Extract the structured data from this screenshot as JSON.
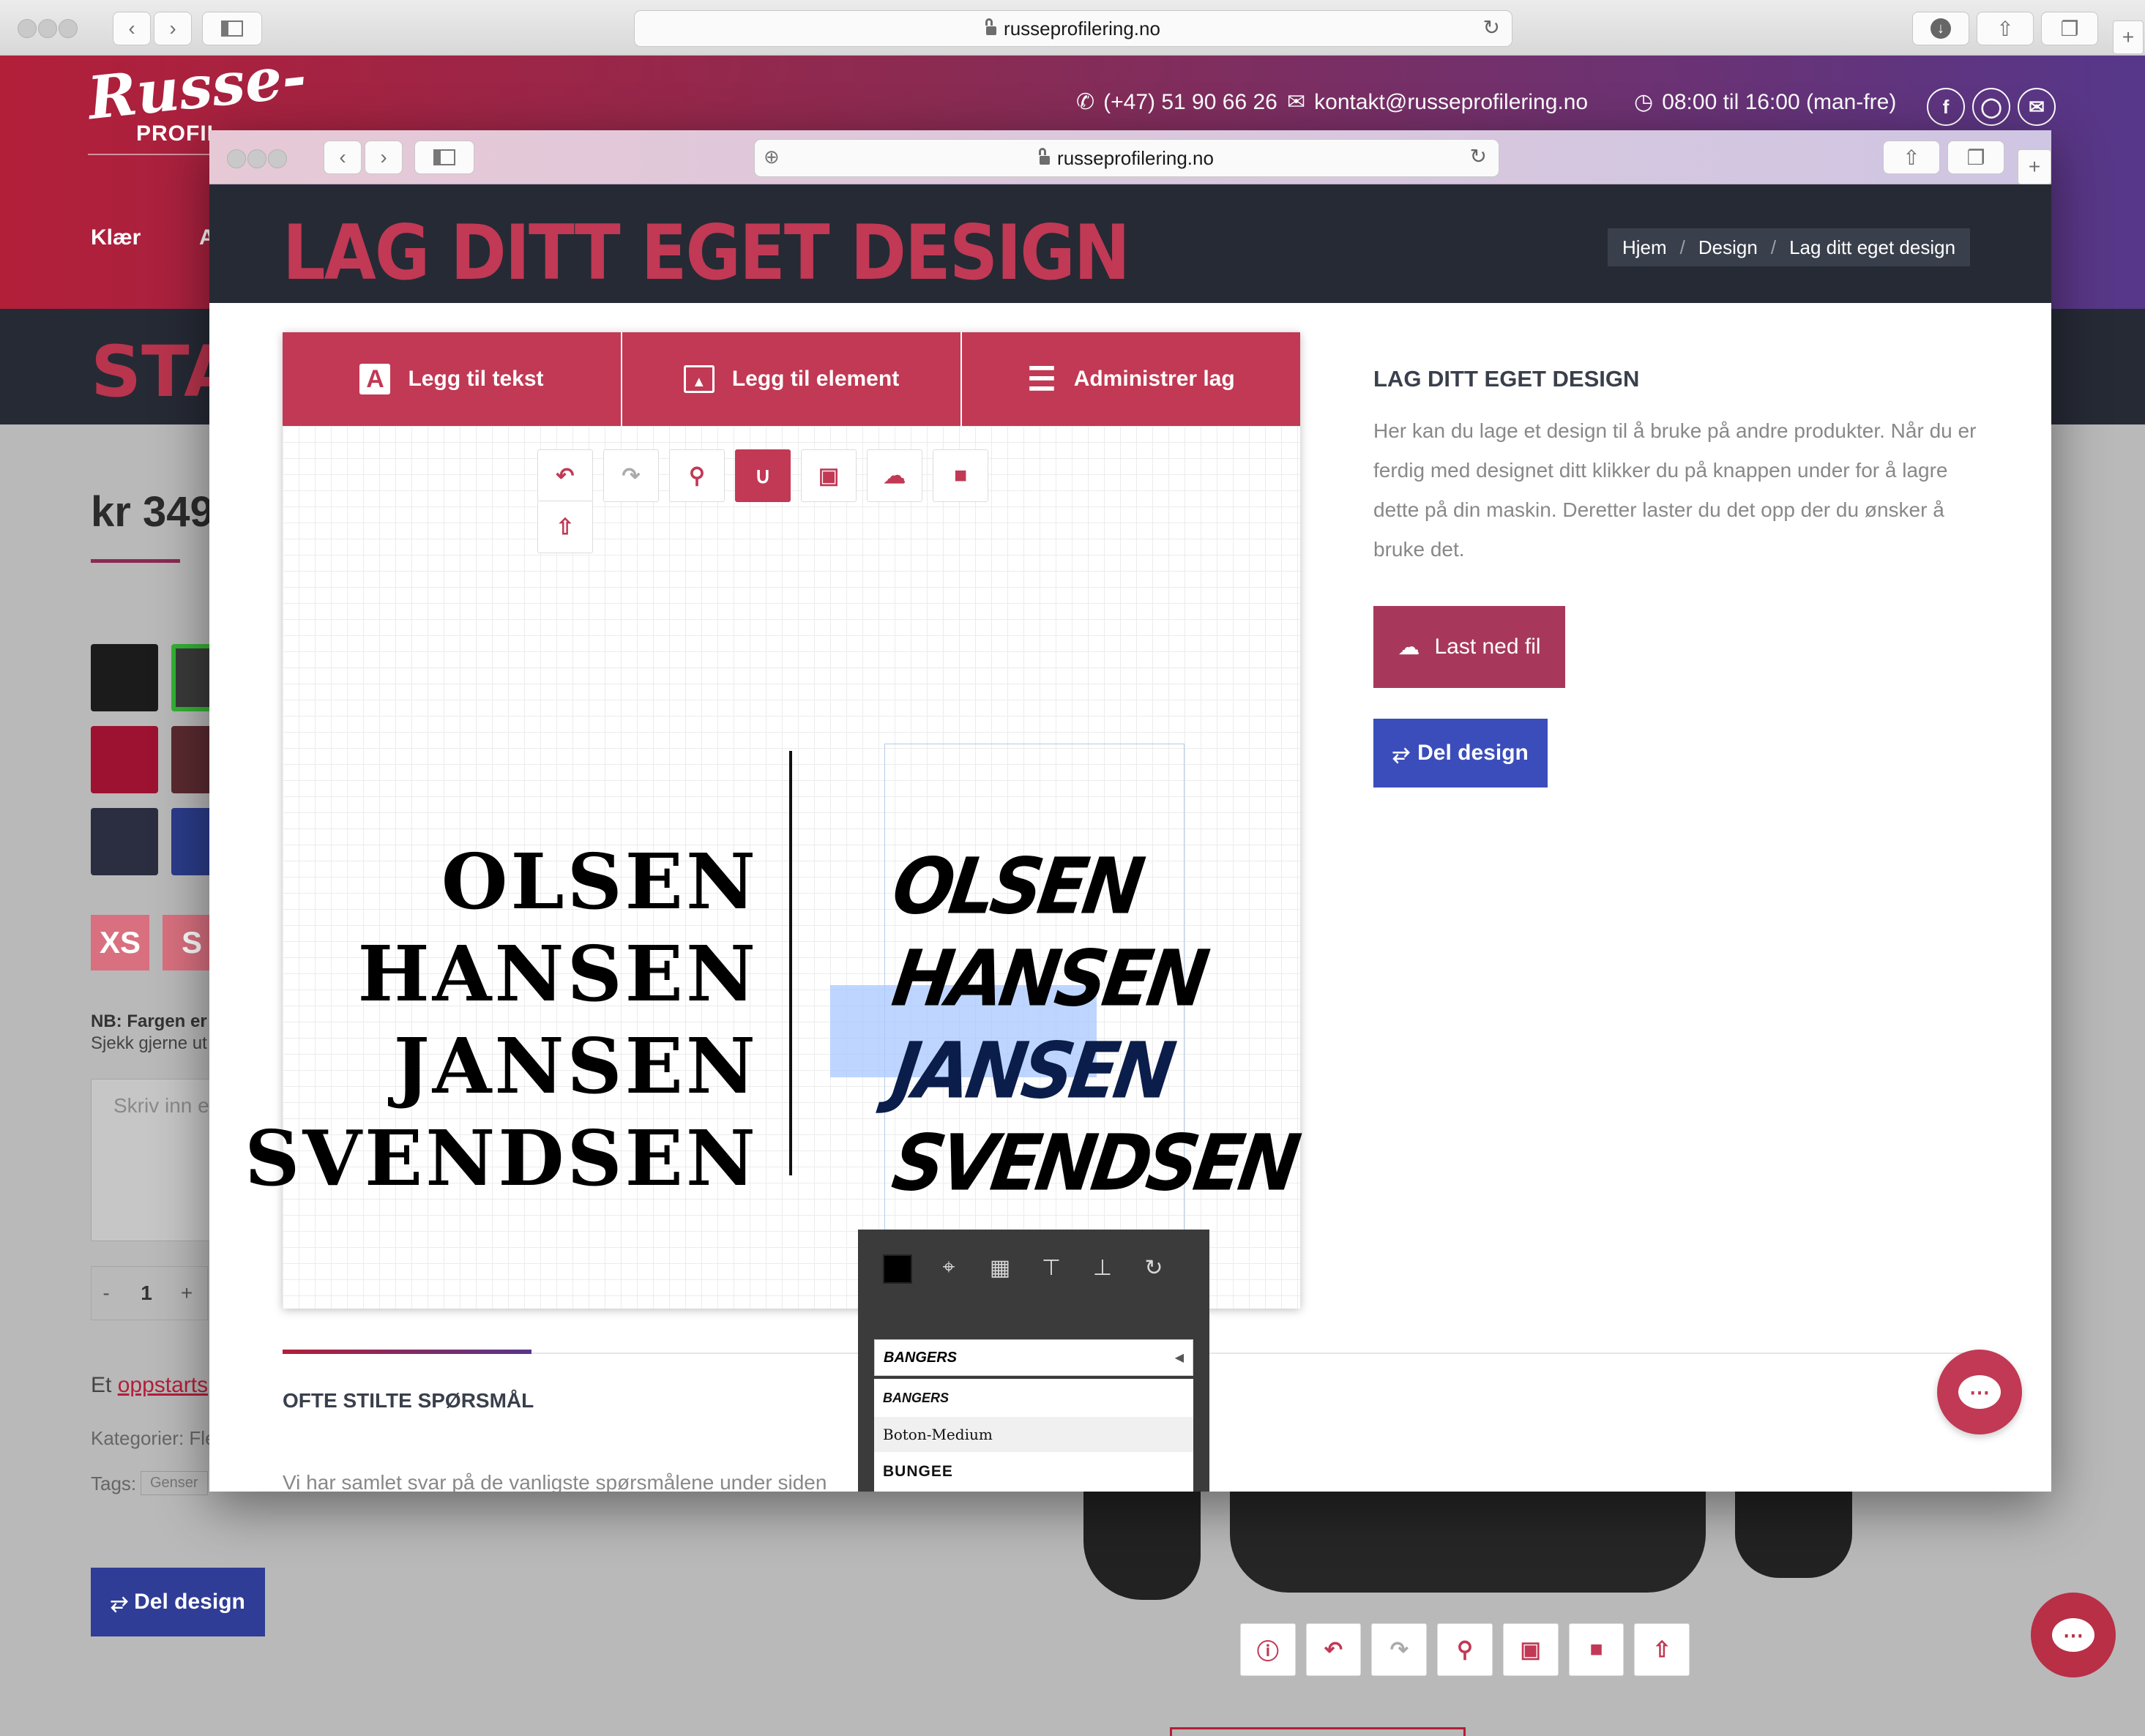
{
  "outer_browser": {
    "url": "russeprofilering.no"
  },
  "bg_page": {
    "logo_main": "Russe-",
    "logo_sub": "PROFIL",
    "phone": "(+47) 51 90 66 26",
    "email": "kontakt@russeprofilering.no",
    "hours": "08:00 til 16:00 (man-fre)",
    "nav_1": "Klær",
    "nav_2": "A",
    "band_title": "STA",
    "price": "kr 349",
    "sizes": [
      "XS",
      "S"
    ],
    "note_bold": "NB: Fargen er",
    "note_sub": "Sjekk gjerne ut",
    "textarea_placeholder": "Skriv inn e",
    "qty_minus": "-",
    "qty_value": "1",
    "qty_plus": "+",
    "text_prefix": "Et",
    "text_link": "oppstarts",
    "categories": "Kategorier: Fle",
    "tags": "Tags:",
    "tag_1": "Genser",
    "share_button": "Del design"
  },
  "modal": {
    "url": "russeprofilering.no",
    "title": "LAG DITT EGET DESIGN",
    "breadcrumb": {
      "home": "Hjem",
      "sep": "/",
      "design": "Design",
      "current": "Lag ditt eget design"
    },
    "tabs": {
      "add_text": "Legg til tekst",
      "add_element": "Legg til element",
      "layers": "Administrer lag"
    },
    "canvas_text_left": [
      "OLSEN",
      "HANSEN",
      "JANSEN",
      "SVENDSEN"
    ],
    "canvas_text_right": [
      "OLSEN",
      "HANSEN",
      "JANSEN",
      "SVENDSEN"
    ],
    "side_heading": "LAG DITT EGET DESIGN",
    "side_text": "Her kan du lage et design til å bruke på andre produkter. Når du er ferdig med designet ditt klikker du på knappen under for å lagre dette på din maskin. Deretter laster du det opp der du ønsker å bruke det.",
    "download_button": "Last ned fil",
    "share_button": "Del design",
    "faq_heading": "OFTE STILTE SPØRSMÅL",
    "faq_text": "Vi har samlet svar på de vanligste spørsmålene under siden",
    "font_selected": "BANGERS",
    "font_options": [
      "BANGERS",
      "Boton-Medium",
      "BUNGEE"
    ]
  },
  "colors": {
    "brand_red": "#c13954",
    "share_blue": "#3b4dbb",
    "download_bg": "#a8385b",
    "dark_header": "#262a35"
  }
}
